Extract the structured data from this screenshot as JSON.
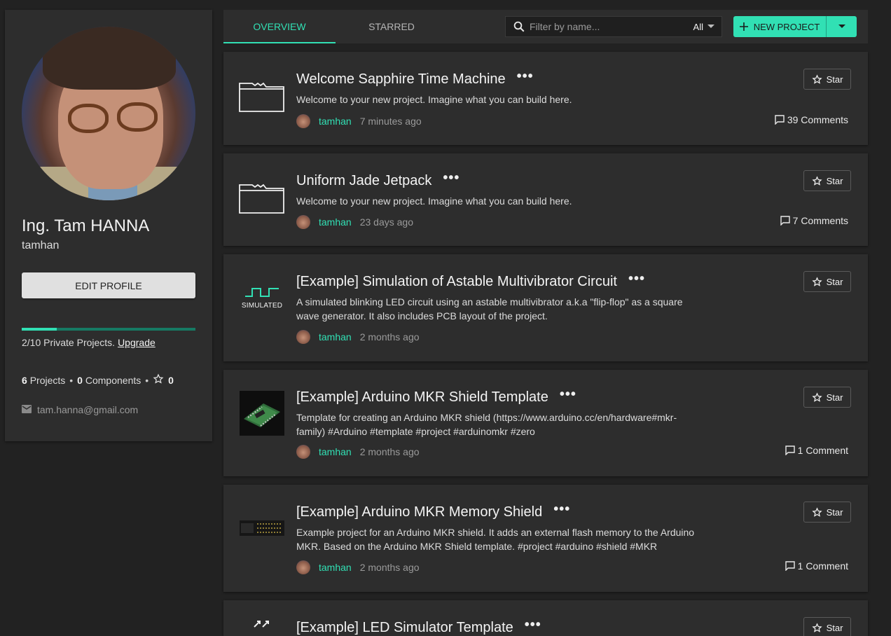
{
  "profile": {
    "name": "Ing. Tam HANNA",
    "username": "tamhan",
    "edit_label": "EDIT PROFILE",
    "quota_fraction": 0.2,
    "quota_text": "2/10 Private Projects.",
    "upgrade_label": "Upgrade",
    "projects_count": "6",
    "projects_label": "Projects",
    "components_count": "0",
    "components_label": "Components",
    "stars_count": "0",
    "email": "tam.hanna@gmail.com"
  },
  "tabs": {
    "overview": "OVERVIEW",
    "starred": "STARRED"
  },
  "filter": {
    "placeholder": "Filter by name...",
    "scope": "All"
  },
  "new_project_label": "NEW PROJECT",
  "star_label": "Star",
  "projects": [
    {
      "title": "Welcome Sapphire Time Machine",
      "description": "Welcome to your new project. Imagine what you can build here.",
      "owner": "tamhan",
      "time": "7 minutes ago",
      "comments": "39 Comments",
      "thumb": "folder-icon"
    },
    {
      "title": "Uniform Jade Jetpack",
      "description": "Welcome to your new project. Imagine what you can build here.",
      "owner": "tamhan",
      "time": "23 days ago",
      "comments": "7 Comments",
      "thumb": "folder-icon"
    },
    {
      "title": "[Example] Simulation of Astable Multivibrator Circuit",
      "description": "A simulated blinking LED circuit using an astable multivibrator a.k.a \"flip-flop\" as a square wave generator. It also includes PCB layout of the project.",
      "owner": "tamhan",
      "time": "2 months ago",
      "comments": "",
      "thumb": "square-wave-icon",
      "thumb_label": "SIMULATED"
    },
    {
      "title": "[Example] Arduino MKR Shield Template",
      "description": "Template for creating an Arduino MKR shield (https://www.arduino.cc/en/hardware#mkr-family) #Arduino #template #project #arduinomkr #zero",
      "owner": "tamhan",
      "time": "2 months ago",
      "comments": "1 Comment",
      "thumb": "pcb-image"
    },
    {
      "title": "[Example] Arduino MKR Memory Shield",
      "description": "Example project for an Arduino MKR shield. It adds an external flash memory to the Arduino MKR. Based on the Arduino MKR Shield template. #project #arduino #shield #MKR",
      "owner": "tamhan",
      "time": "2 months ago",
      "comments": "1 Comment",
      "thumb": "pcb-image"
    },
    {
      "title": "[Example] LED Simulator Template",
      "description": "",
      "owner": "",
      "time": "",
      "comments": "",
      "thumb": "expand-arrows-icon"
    }
  ],
  "colors": {
    "accent": "#31e0b4",
    "background": "#222222",
    "card": "#2d2d2d"
  }
}
